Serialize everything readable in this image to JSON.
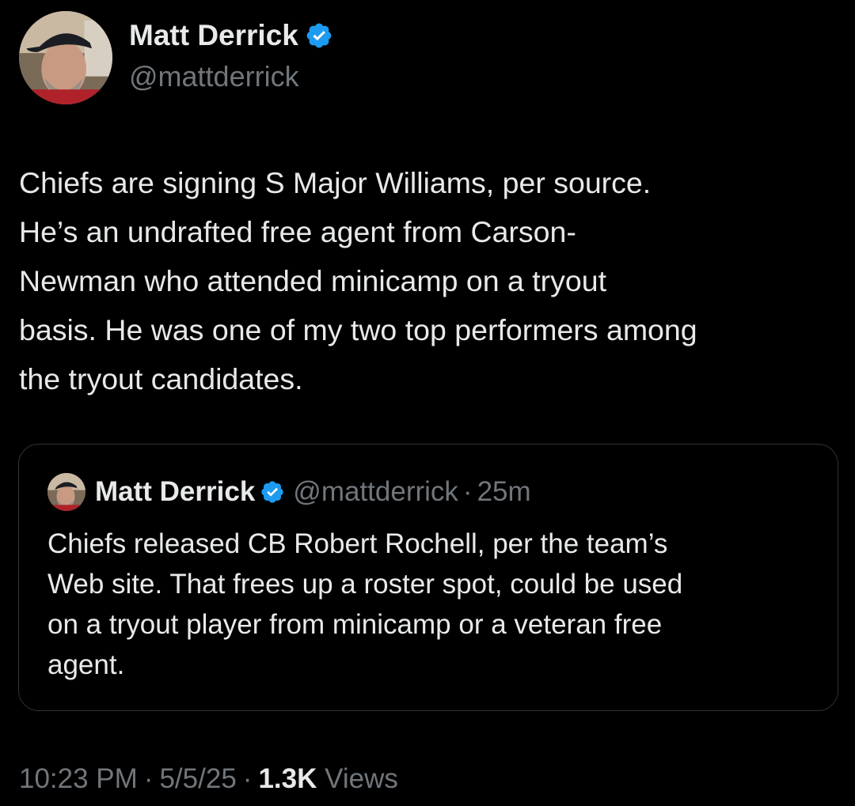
{
  "author": {
    "name": "Matt Derrick",
    "handle": "@mattderrick",
    "verified_color": "#1d9bf0"
  },
  "tweet": {
    "lines": [
      "Chiefs are signing S Major Williams,  per source.",
      "He’s an undrafted free agent from Carson-",
      "Newman who attended minicamp on a tryout",
      "basis. He was one of my two top performers among",
      "the tryout candidates."
    ]
  },
  "quote": {
    "name": "Matt Derrick",
    "handle": "@mattderrick",
    "dot": "·",
    "time": "25m",
    "lines": [
      "Chiefs  released CB Robert Rochell, per the team’s",
      "Web site. That frees up a roster spot, could be used",
      "on a tryout player from minicamp or a veteran free",
      "agent."
    ]
  },
  "meta": {
    "time": "10:23 PM",
    "sep1": "·",
    "date": "5/5/25",
    "sep2": "·",
    "views_count": "1.3K",
    "views_label": "Views"
  },
  "icons": {
    "verified": "verified-badge-icon",
    "avatar": "profile-photo"
  }
}
